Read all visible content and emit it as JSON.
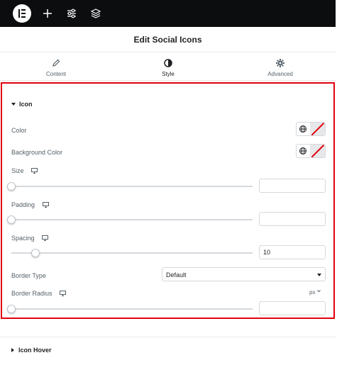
{
  "toolbar": {
    "icons": [
      "elementor-logo-icon",
      "plus-icon",
      "sliders-icon",
      "layers-icon"
    ]
  },
  "panel": {
    "title": "Edit Social Icons"
  },
  "tabs": [
    {
      "label": "Content",
      "icon": "pencil-icon",
      "active": false
    },
    {
      "label": "Style",
      "icon": "contrast-icon",
      "active": true
    },
    {
      "label": "Advanced",
      "icon": "gear-icon",
      "active": false
    }
  ],
  "icon_section": {
    "title": "Icon",
    "color_label": "Color",
    "bg_color_label": "Background Color",
    "size": {
      "label": "Size",
      "value": ""
    },
    "padding": {
      "label": "Padding",
      "value": ""
    },
    "spacing": {
      "label": "Spacing",
      "value": "10"
    },
    "border_type": {
      "label": "Border Type",
      "value": "Default"
    },
    "border_radius": {
      "label": "Border Radius",
      "unit": "px",
      "value": ""
    }
  },
  "hover_section": {
    "title": "Icon Hover"
  },
  "colors": {
    "highlight": "#e3000e",
    "topbar": "#0c0d0e"
  }
}
